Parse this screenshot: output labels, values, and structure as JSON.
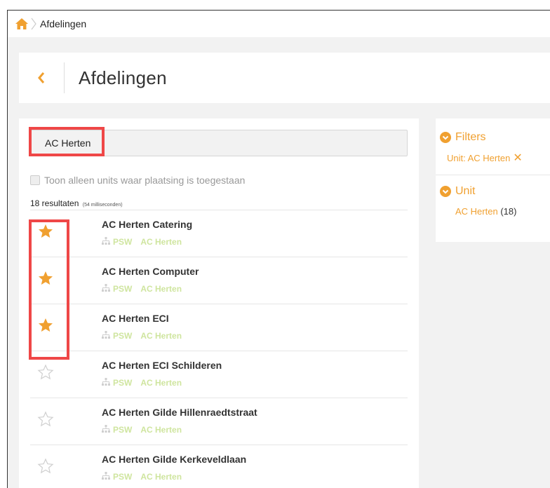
{
  "breadcrumb": {
    "current": "Afdelingen"
  },
  "header": {
    "title": "Afdelingen"
  },
  "search": {
    "value": "AC Herten"
  },
  "options": {
    "placement_only_label": "Toon alleen units waar plaatsing is toegestaan"
  },
  "results": {
    "count_label": "18 resultaten",
    "time_label": "(54 milliseconden)"
  },
  "items": [
    {
      "title": "AC Herten Catering",
      "org": "PSW",
      "unit": "AC Herten",
      "favorite": true
    },
    {
      "title": "AC Herten Computer",
      "org": "PSW",
      "unit": "AC Herten",
      "favorite": true
    },
    {
      "title": "AC Herten ECI",
      "org": "PSW",
      "unit": "AC Herten",
      "favorite": true
    },
    {
      "title": "AC Herten ECI Schilderen",
      "org": "PSW",
      "unit": "AC Herten",
      "favorite": false
    },
    {
      "title": "AC Herten Gilde Hillenraedtstraat",
      "org": "PSW",
      "unit": "AC Herten",
      "favorite": false
    },
    {
      "title": "AC Herten Gilde Kerkeveldlaan",
      "org": "PSW",
      "unit": "AC Herten",
      "favorite": false
    }
  ],
  "sidebar": {
    "filters_label": "Filters",
    "active_filter": "Unit: AC Herten",
    "remove_symbol": "✕",
    "unit_label": "Unit",
    "unit_facet": {
      "name": "AC Herten",
      "count": "(18)"
    }
  },
  "colors": {
    "accent": "#f0a030",
    "highlight": "#ef4747",
    "meta": "#cfe59f"
  }
}
